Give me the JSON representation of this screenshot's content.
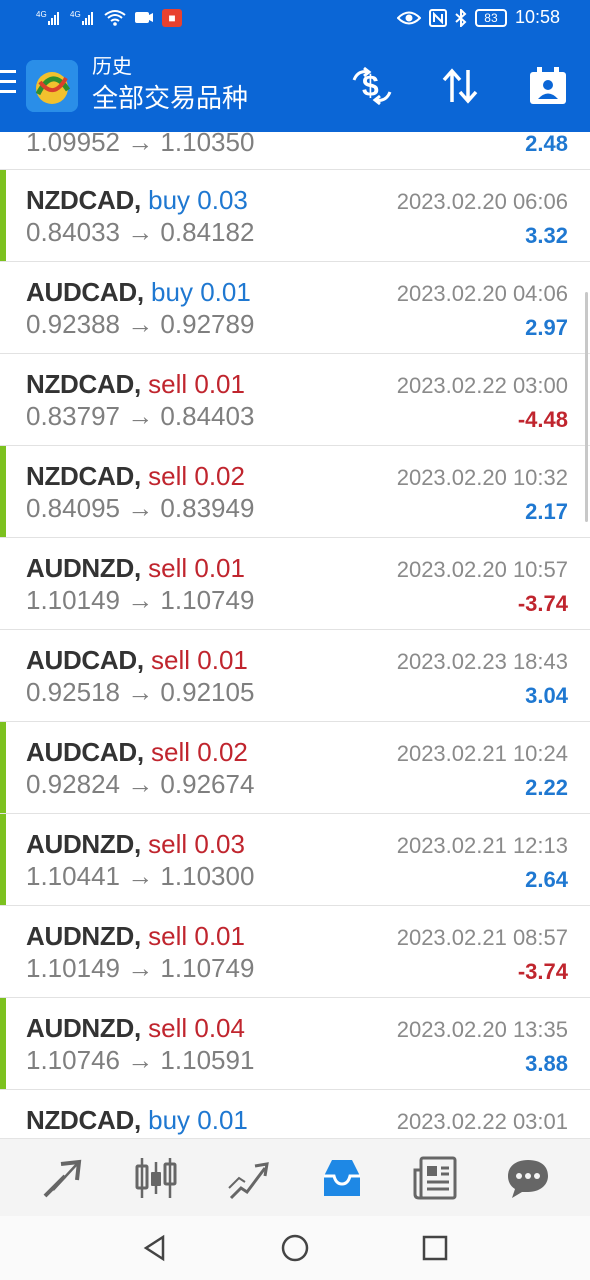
{
  "status_bar": {
    "left_icons": [
      "signal-4g-icon",
      "signal-4g-icon",
      "wifi-icon",
      "cast-icon",
      "notification-app-icon"
    ],
    "right_icons": [
      "eye-icon",
      "nfc-icon",
      "bluetooth-icon"
    ],
    "battery": "83",
    "time": "10:58"
  },
  "app_bar": {
    "title_small": "历史",
    "title_big": "全部交易品种",
    "actions": [
      "currency-swap-icon",
      "sort-icon",
      "calendar-icon"
    ]
  },
  "colors": {
    "appbar_blue": "#0b66d6",
    "buy_blue": "#1f78d1",
    "sell_red": "#c0252e",
    "accent_green": "#7cc11f"
  },
  "trades_partial_top": {
    "prices": "1.09952 → 1.10350",
    "profit": "2.48",
    "sign": "pos"
  },
  "trades": [
    {
      "symbol": "NZDCAD,",
      "side": "buy",
      "volume": "0.03",
      "prices": "0.84033 → 0.84182",
      "datetime": "2023.02.20 06:06",
      "profit": "3.32",
      "sign": "pos",
      "accent": true
    },
    {
      "symbol": "AUDCAD,",
      "side": "buy",
      "volume": "0.01",
      "prices": "0.92388 → 0.92789",
      "datetime": "2023.02.20 04:06",
      "profit": "2.97",
      "sign": "pos",
      "accent": false
    },
    {
      "symbol": "NZDCAD,",
      "side": "sell",
      "volume": "0.01",
      "prices": "0.83797 → 0.84403",
      "datetime": "2023.02.22 03:00",
      "profit": "-4.48",
      "sign": "neg",
      "accent": false
    },
    {
      "symbol": "NZDCAD,",
      "side": "sell",
      "volume": "0.02",
      "prices": "0.84095 → 0.83949",
      "datetime": "2023.02.20 10:32",
      "profit": "2.17",
      "sign": "pos",
      "accent": true
    },
    {
      "symbol": "AUDNZD,",
      "side": "sell",
      "volume": "0.01",
      "prices": "1.10149 → 1.10749",
      "datetime": "2023.02.20 10:57",
      "profit": "-3.74",
      "sign": "neg",
      "accent": false
    },
    {
      "symbol": "AUDCAD,",
      "side": "sell",
      "volume": "0.01",
      "prices": "0.92518 → 0.92105",
      "datetime": "2023.02.23 18:43",
      "profit": "3.04",
      "sign": "pos",
      "accent": false
    },
    {
      "symbol": "AUDCAD,",
      "side": "sell",
      "volume": "0.02",
      "prices": "0.92824 → 0.92674",
      "datetime": "2023.02.21 10:24",
      "profit": "2.22",
      "sign": "pos",
      "accent": true
    },
    {
      "symbol": "AUDNZD,",
      "side": "sell",
      "volume": "0.03",
      "prices": "1.10441 → 1.10300",
      "datetime": "2023.02.21 12:13",
      "profit": "2.64",
      "sign": "pos",
      "accent": true
    },
    {
      "symbol": "AUDNZD,",
      "side": "sell",
      "volume": "0.01",
      "prices": "1.10149 → 1.10749",
      "datetime": "2023.02.21 08:57",
      "profit": "-3.74",
      "sign": "neg",
      "accent": false
    },
    {
      "symbol": "AUDNZD,",
      "side": "sell",
      "volume": "0.04",
      "prices": "1.10746 → 1.10591",
      "datetime": "2023.02.20 13:35",
      "profit": "3.88",
      "sign": "pos",
      "accent": true
    },
    {
      "symbol": "NZDCAD,",
      "side": "buy",
      "volume": "0.01",
      "prices": "",
      "datetime": "2023.02.22 03:01",
      "profit": "",
      "sign": "pos",
      "accent": false
    }
  ],
  "tab_bar": {
    "tabs": [
      "quotes-icon",
      "chart-icon",
      "trade-icon",
      "history-icon",
      "news-icon",
      "chat-icon"
    ],
    "active": "history-icon"
  },
  "nav_bar": {
    "buttons": [
      "back-icon",
      "home-icon",
      "recents-icon"
    ]
  }
}
